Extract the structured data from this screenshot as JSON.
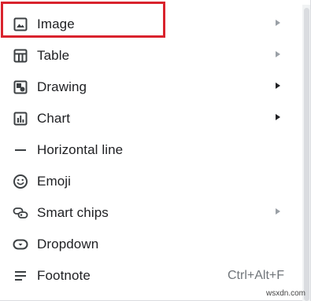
{
  "menu": {
    "items": [
      {
        "label": "Image",
        "icon": "image-icon",
        "submenu": true
      },
      {
        "label": "Table",
        "icon": "table-icon",
        "submenu": true
      },
      {
        "label": "Drawing",
        "icon": "drawing-icon",
        "submenu": true
      },
      {
        "label": "Chart",
        "icon": "chart-icon",
        "submenu": true
      },
      {
        "label": "Horizontal line",
        "icon": "horizontal-line-icon",
        "submenu": false
      },
      {
        "label": "Emoji",
        "icon": "emoji-icon",
        "submenu": false
      },
      {
        "label": "Smart chips",
        "icon": "smart-chips-icon",
        "submenu": true
      },
      {
        "label": "Dropdown",
        "icon": "dropdown-icon",
        "submenu": false
      },
      {
        "label": "Footnote",
        "icon": "footnote-icon",
        "submenu": false,
        "shortcut": "Ctrl+Alt+F"
      }
    ]
  },
  "watermark": "wsxdn.com",
  "colors": {
    "highlight": "#d9232d",
    "text": "#202124",
    "muted": "#70757a",
    "icon": "#3c4043"
  }
}
